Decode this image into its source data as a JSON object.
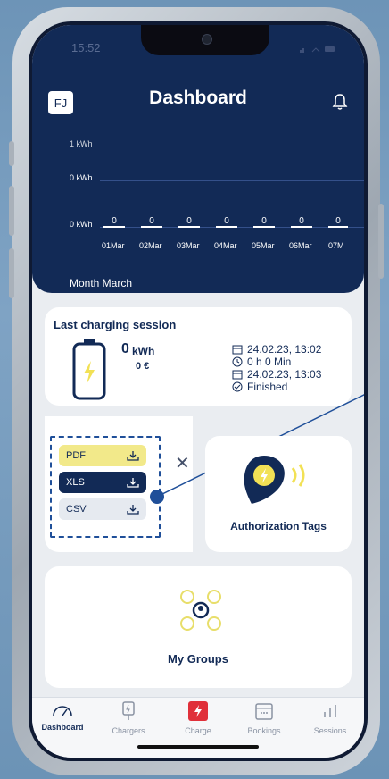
{
  "status": {
    "time": "15:52"
  },
  "header": {
    "avatar": "FJ",
    "title": "Dashboard",
    "month_label": "Month March"
  },
  "chart_data": {
    "type": "bar",
    "categories": [
      "01Mar",
      "02Mar",
      "03Mar",
      "04Mar",
      "05Mar",
      "06Mar",
      "07M"
    ],
    "values": [
      0,
      0,
      0,
      0,
      0,
      0,
      0
    ],
    "data_labels": [
      "0",
      "0",
      "0",
      "0",
      "0",
      "0",
      "0"
    ],
    "y_tick_labels": [
      "1 kWh",
      "0 kWh",
      "0 kWh"
    ],
    "grid": true
  },
  "last_session": {
    "title": "Last charging session",
    "energy_value": "0",
    "energy_unit": "kWh",
    "cost": "0 €",
    "start": "24.02.23, 13:02",
    "duration": "0 h 0 Min",
    "end": "24.02.23, 13:03",
    "status": "Finished"
  },
  "export": {
    "pdf": "PDF",
    "xls": "XLS",
    "csv": "CSV",
    "colors": {
      "pdf": "#f2e98a",
      "xls": "#122a56",
      "csv": "#e6eaf0"
    }
  },
  "auth_tags": {
    "label": "Authorization Tags"
  },
  "groups": {
    "label": "My Groups"
  },
  "nav": {
    "dashboard": "Dashboard",
    "chargers": "Chargers",
    "charge": "Charge",
    "bookings": "Bookings",
    "sessions": "Sessions"
  },
  "colors": {
    "primary": "#122a56",
    "accent_yellow": "#f2e155",
    "charge_red": "#e0303a"
  }
}
